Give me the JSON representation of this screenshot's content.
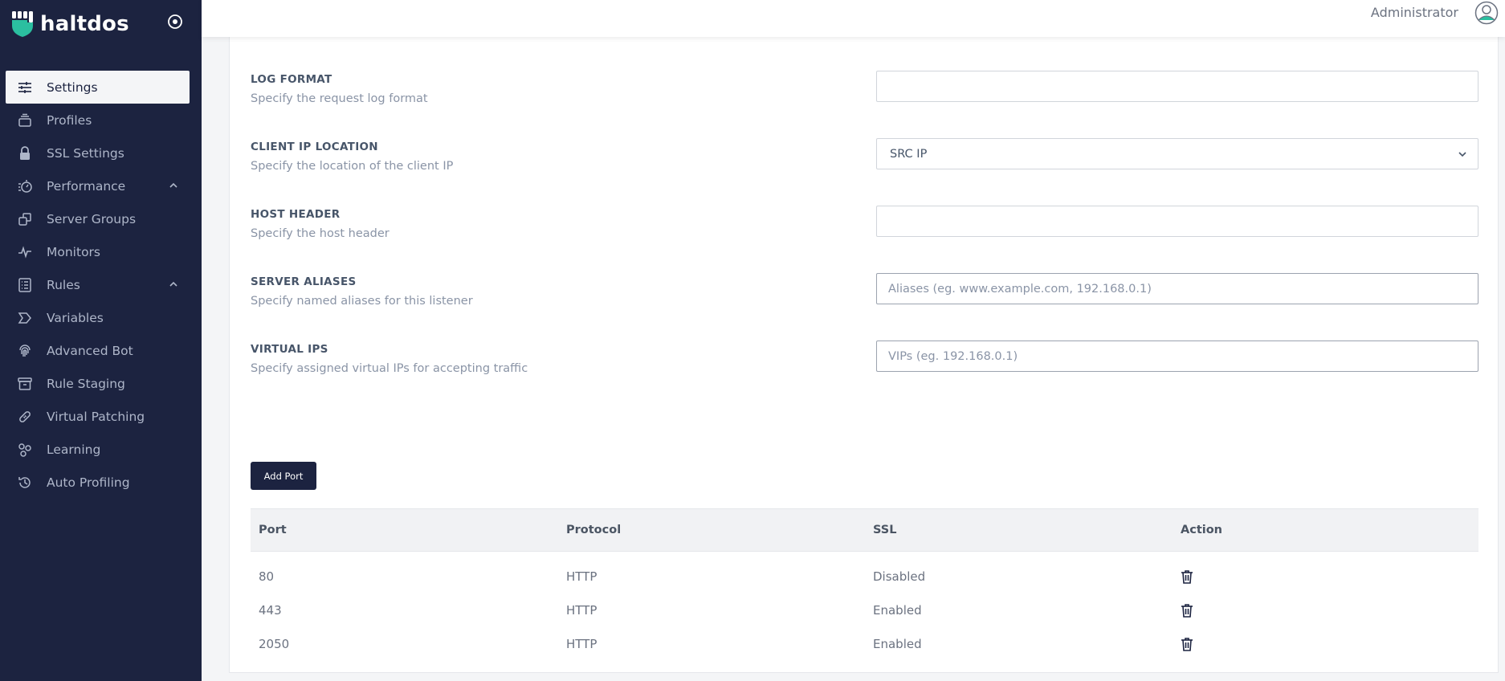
{
  "brand": {
    "name": "haltdos",
    "accent": "#2bbfa0"
  },
  "sidebar": {
    "items": [
      {
        "label": "Settings",
        "icon": "sliders-icon",
        "active": true
      },
      {
        "label": "Profiles",
        "icon": "profiles-icon"
      },
      {
        "label": "SSL Settings",
        "icon": "lock-icon"
      },
      {
        "label": "Performance",
        "icon": "performance-icon",
        "expandable": true
      },
      {
        "label": "Server Groups",
        "icon": "server-groups-icon"
      },
      {
        "label": "Monitors",
        "icon": "pulse-icon"
      },
      {
        "label": "Rules",
        "icon": "rules-icon",
        "expandable": true
      },
      {
        "label": "Variables",
        "icon": "variables-icon"
      },
      {
        "label": "Advanced Bot",
        "icon": "fingerprint-icon"
      },
      {
        "label": "Rule Staging",
        "icon": "archive-icon"
      },
      {
        "label": "Virtual Patching",
        "icon": "bandage-icon"
      },
      {
        "label": "Learning",
        "icon": "learning-icon"
      },
      {
        "label": "Auto Profiling",
        "icon": "history-icon"
      }
    ]
  },
  "header": {
    "user": "Administrator"
  },
  "form": {
    "log_format": {
      "label": "LOG FORMAT",
      "desc": "Specify the request log format",
      "value": ""
    },
    "client_ip": {
      "label": "CLIENT IP LOCATION",
      "desc": "Specify the location of the client IP",
      "value": "SRC IP"
    },
    "host_header": {
      "label": "HOST HEADER",
      "desc": "Specify the host header",
      "value": ""
    },
    "server_aliases": {
      "label": "SERVER ALIASES",
      "desc": "Specify named aliases for this listener",
      "placeholder": "Aliases (eg. www.example.com, 192.168.0.1)"
    },
    "virtual_ips": {
      "label": "VIRTUAL IPS",
      "desc": "Specify assigned virtual IPs for accepting traffic",
      "placeholder": "VIPs (eg. 192.168.0.1)"
    }
  },
  "ports": {
    "add_label": "Add Port",
    "columns": [
      "Port",
      "Protocol",
      "SSL",
      "Action"
    ],
    "rows": [
      {
        "port": "80",
        "protocol": "HTTP",
        "ssl": "Disabled"
      },
      {
        "port": "443",
        "protocol": "HTTP",
        "ssl": "Enabled"
      },
      {
        "port": "2050",
        "protocol": "HTTP",
        "ssl": "Enabled"
      }
    ]
  }
}
